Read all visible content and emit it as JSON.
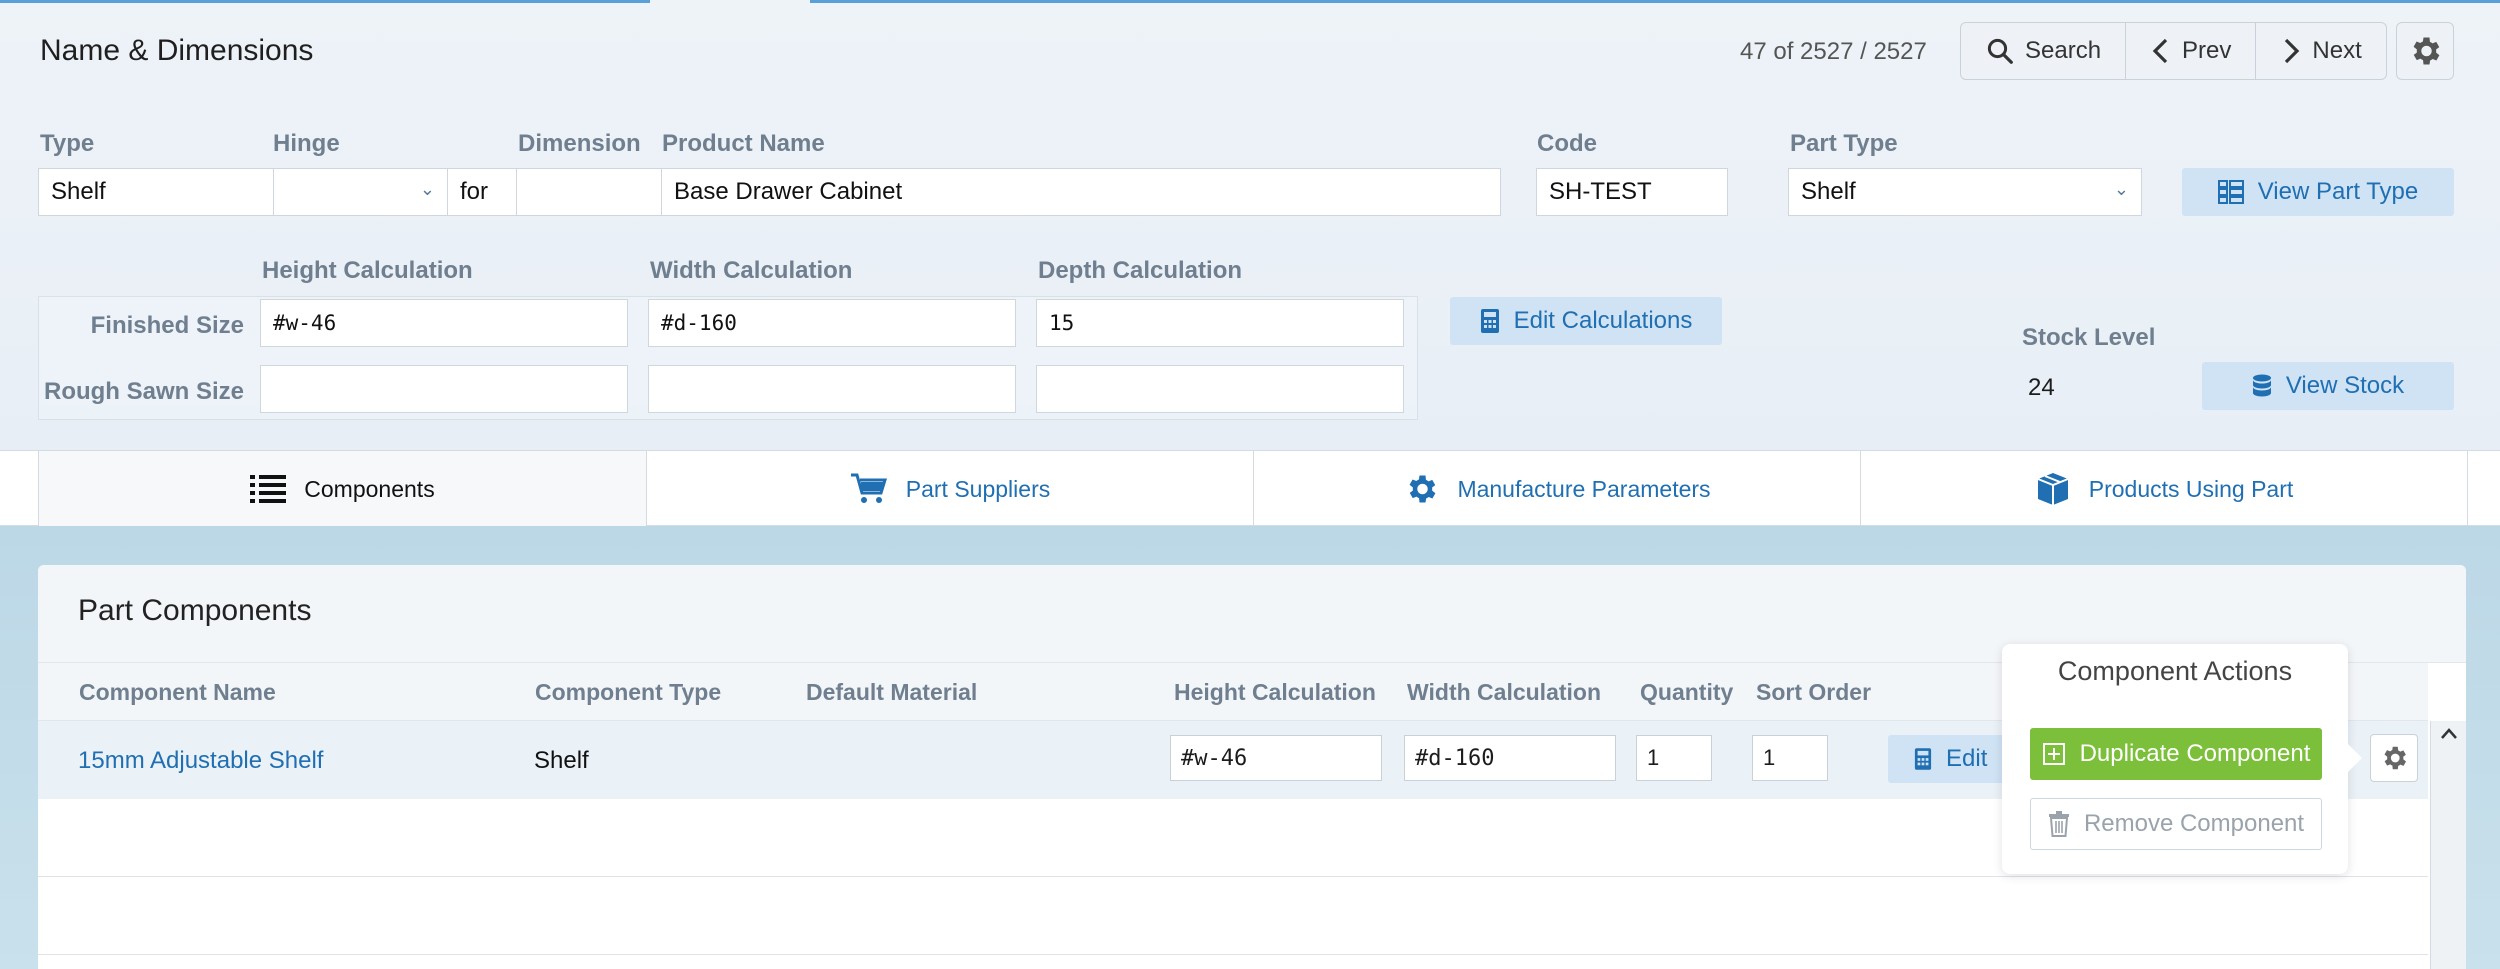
{
  "header": {
    "title": "Name & Dimensions",
    "record_count": "47 of 2527 / 2527",
    "search_label": "Search",
    "prev_label": "Prev",
    "next_label": "Next"
  },
  "fields": {
    "type_label": "Type",
    "type_value": "Shelf",
    "hinge_label": "Hinge",
    "hinge_value": "",
    "for_text": "for",
    "dimension_label": "Dimension",
    "dimension_value": "",
    "product_name_label": "Product Name",
    "product_name_value": "Base Drawer Cabinet",
    "code_label": "Code",
    "code_value": "SH-TEST",
    "part_type_label": "Part Type",
    "part_type_value": "Shelf",
    "view_part_type_label": "View Part Type"
  },
  "calculations": {
    "height_label": "Height Calculation",
    "width_label": "Width Calculation",
    "depth_label": "Depth Calculation",
    "finished_size_label": "Finished Size",
    "rough_sawn_label": "Rough Sawn Size",
    "finished_height": "#w-46",
    "finished_width": "#d-160",
    "finished_depth": "15",
    "rough_height": "",
    "rough_width": "",
    "rough_depth": "",
    "edit_label": "Edit Calculations"
  },
  "stock": {
    "label": "Stock Level",
    "value": "24",
    "view_label": "View Stock"
  },
  "tabs": [
    {
      "label": "Components",
      "icon": "list-icon",
      "active": true
    },
    {
      "label": "Part Suppliers",
      "icon": "cart-icon",
      "active": false
    },
    {
      "label": "Manufacture Parameters",
      "icon": "gear-icon",
      "active": false
    },
    {
      "label": "Products Using Part",
      "icon": "box-icon",
      "active": false
    }
  ],
  "components": {
    "title": "Part Components",
    "columns": [
      "Component Name",
      "Component Type",
      "Default Material",
      "Height Calculation",
      "Width Calculation",
      "Quantity",
      "Sort Order"
    ],
    "rows": [
      {
        "name": "15mm Adjustable Shelf",
        "type": "Shelf",
        "material": "",
        "height": "#w-46",
        "width": "#d-160",
        "quantity": "1",
        "sort_order": "1",
        "edit_label": "Edit"
      }
    ]
  },
  "popover": {
    "title": "Component Actions",
    "duplicate_label": "Duplicate Component",
    "remove_label": "Remove Component"
  },
  "colors": {
    "accent": "#1f6fb2",
    "success": "#7cbf3a",
    "light_button": "#cfe3f5"
  }
}
